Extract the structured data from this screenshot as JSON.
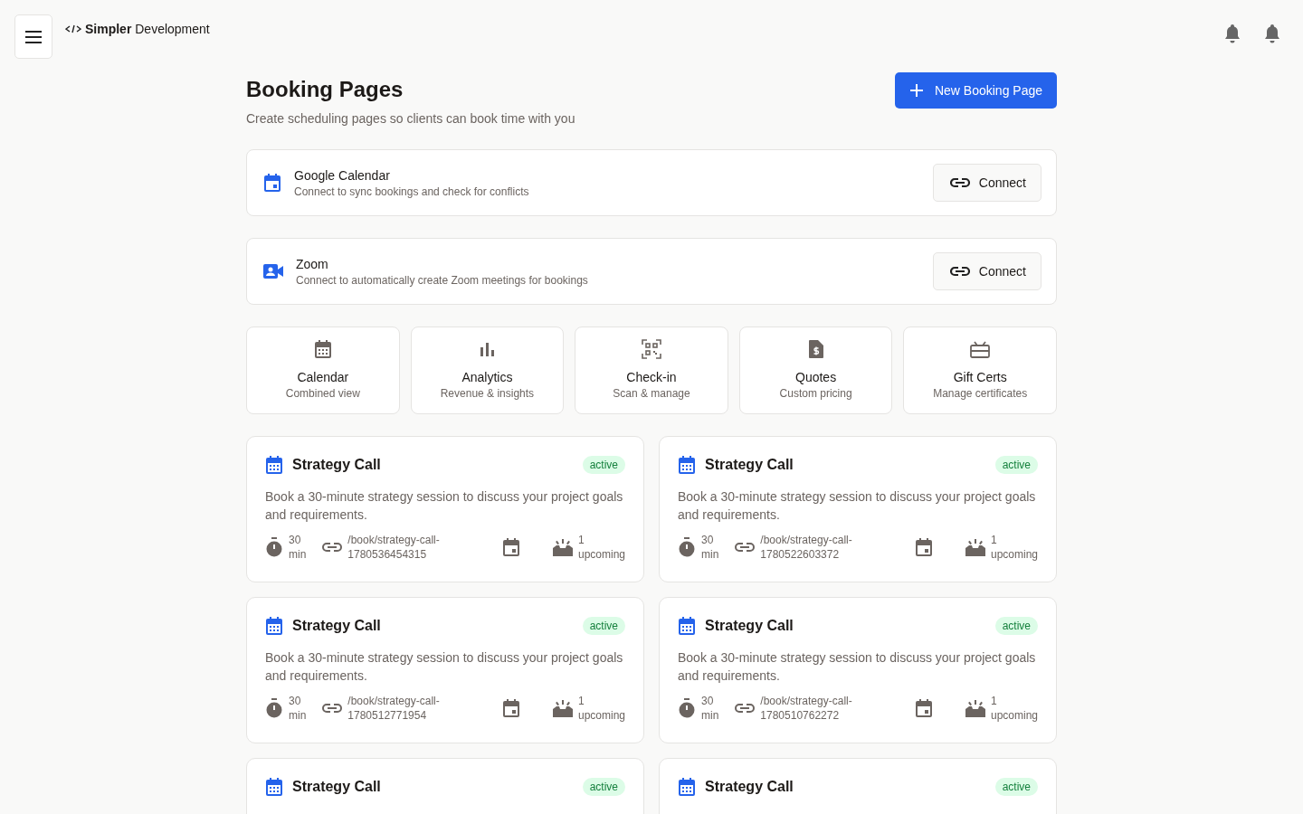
{
  "brand": {
    "bold": "Simpler",
    "rest": "Development"
  },
  "header": {
    "title": "Booking Pages",
    "subtitle": "Create scheduling pages so clients can book time with you",
    "new_button": "New Booking Page"
  },
  "integrations": [
    {
      "kind": "calendar",
      "name": "Google Calendar",
      "description": "Connect to sync bookings and check for conflicts",
      "button": "Connect"
    },
    {
      "kind": "video",
      "name": "Zoom",
      "description": "Connect to automatically create Zoom meetings for bookings",
      "button": "Connect"
    }
  ],
  "tiles": [
    {
      "kind": "calendar",
      "label": "Calendar",
      "sub": "Combined view"
    },
    {
      "kind": "chart",
      "label": "Analytics",
      "sub": "Revenue & insights"
    },
    {
      "kind": "qr",
      "label": "Check-in",
      "sub": "Scan & manage"
    },
    {
      "kind": "quote",
      "label": "Quotes",
      "sub": "Custom pricing"
    },
    {
      "kind": "gift",
      "label": "Gift Certs",
      "sub": "Manage certificates"
    }
  ],
  "pages": [
    {
      "title": "Strategy Call",
      "status": "active",
      "description": "Book a 30-minute strategy session to discuss your project goals and requirements.",
      "duration": [
        "30",
        "min"
      ],
      "path": [
        "/book/strategy-call-",
        "1780536454315"
      ],
      "upcoming": [
        "1",
        "upcoming"
      ]
    },
    {
      "title": "Strategy Call",
      "status": "active",
      "description": "Book a 30-minute strategy session to discuss your project goals and requirements.",
      "duration": [
        "30",
        "min"
      ],
      "path": [
        "/book/strategy-call-",
        "1780522603372"
      ],
      "upcoming": [
        "1",
        "upcoming"
      ]
    },
    {
      "title": "Strategy Call",
      "status": "active",
      "description": "Book a 30-minute strategy session to discuss your project goals and requirements.",
      "duration": [
        "30",
        "min"
      ],
      "path": [
        "/book/strategy-call-",
        "1780512771954"
      ],
      "upcoming": [
        "1",
        "upcoming"
      ]
    },
    {
      "title": "Strategy Call",
      "status": "active",
      "description": "Book a 30-minute strategy session to discuss your project goals and requirements.",
      "duration": [
        "30",
        "min"
      ],
      "path": [
        "/book/strategy-call-",
        "1780510762272"
      ],
      "upcoming": [
        "1",
        "upcoming"
      ]
    },
    {
      "title": "Strategy Call",
      "status": "active"
    },
    {
      "title": "Strategy Call",
      "status": "active"
    }
  ]
}
